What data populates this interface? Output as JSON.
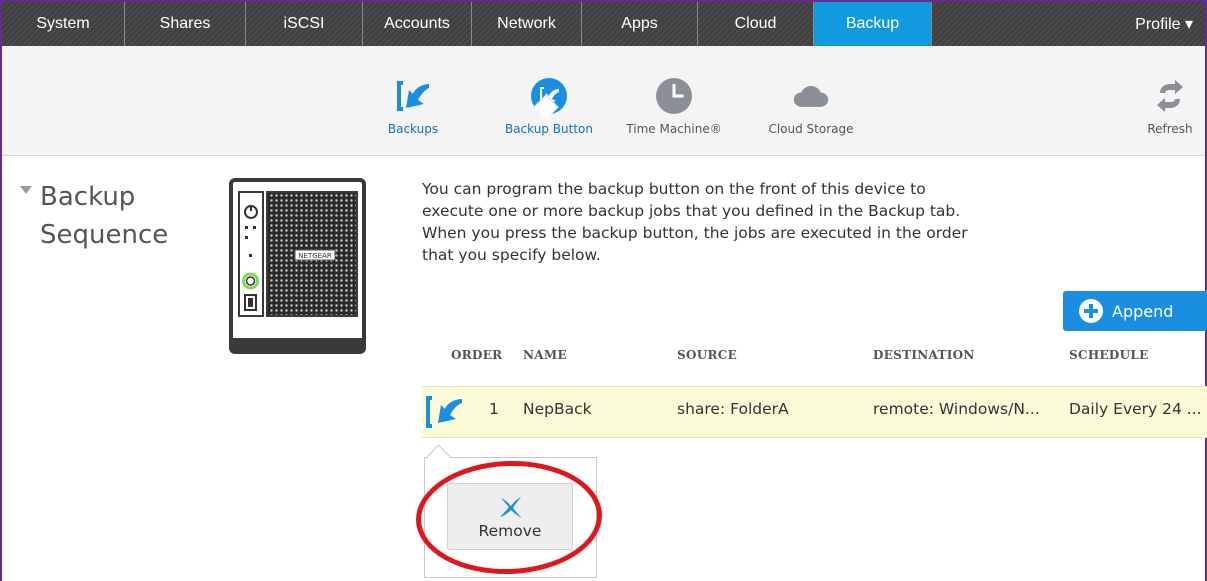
{
  "topnav": {
    "tabs": [
      {
        "label": "System",
        "active": false
      },
      {
        "label": "Shares",
        "active": false
      },
      {
        "label": "iSCSI",
        "active": false
      },
      {
        "label": "Accounts",
        "active": false
      },
      {
        "label": "Network",
        "active": false
      },
      {
        "label": "Apps",
        "active": false
      },
      {
        "label": "Cloud",
        "active": false
      },
      {
        "label": "Backup",
        "active": true
      }
    ],
    "profile_label": "Profile ▾",
    "active_color": "#129ae0"
  },
  "subnav": {
    "items": [
      {
        "label": "Backups",
        "icon": "backup-arrow-icon"
      },
      {
        "label": "Backup Button",
        "icon": "backup-button-icon"
      },
      {
        "label": "Time Machine®",
        "icon": "clock-icon"
      },
      {
        "label": "Cloud Storage",
        "icon": "cloud-icon"
      }
    ],
    "refresh_label": "Refresh",
    "refresh_icon": "refresh-icon"
  },
  "section": {
    "title_line1": "Backup",
    "title_line2": "Sequence"
  },
  "device": {
    "brand": "NETGEAR"
  },
  "description": "You can program the backup button on the front of this device to execute one or more backup jobs that you defined in the Backup tab. When you press the backup button, the jobs are executed in the order that you specify below.",
  "append_label": "Append",
  "table": {
    "headers": {
      "order": "ORDER",
      "name": "NAME",
      "source": "SOURCE",
      "destination": "DESTINATION",
      "schedule": "SCHEDULE"
    },
    "rows": [
      {
        "order": "1",
        "name": "NepBack",
        "source": "share: FolderA",
        "destination": "remote: Windows/N...",
        "schedule": "Daily Every 24 ..."
      }
    ]
  },
  "popup": {
    "remove_label": "Remove",
    "remove_icon": "remove-x-icon"
  },
  "colors": {
    "accent": "#129ae0",
    "frame": "#6a2a8c",
    "row_highlight": "#fcfbd8",
    "annotation": "#e0161e"
  }
}
